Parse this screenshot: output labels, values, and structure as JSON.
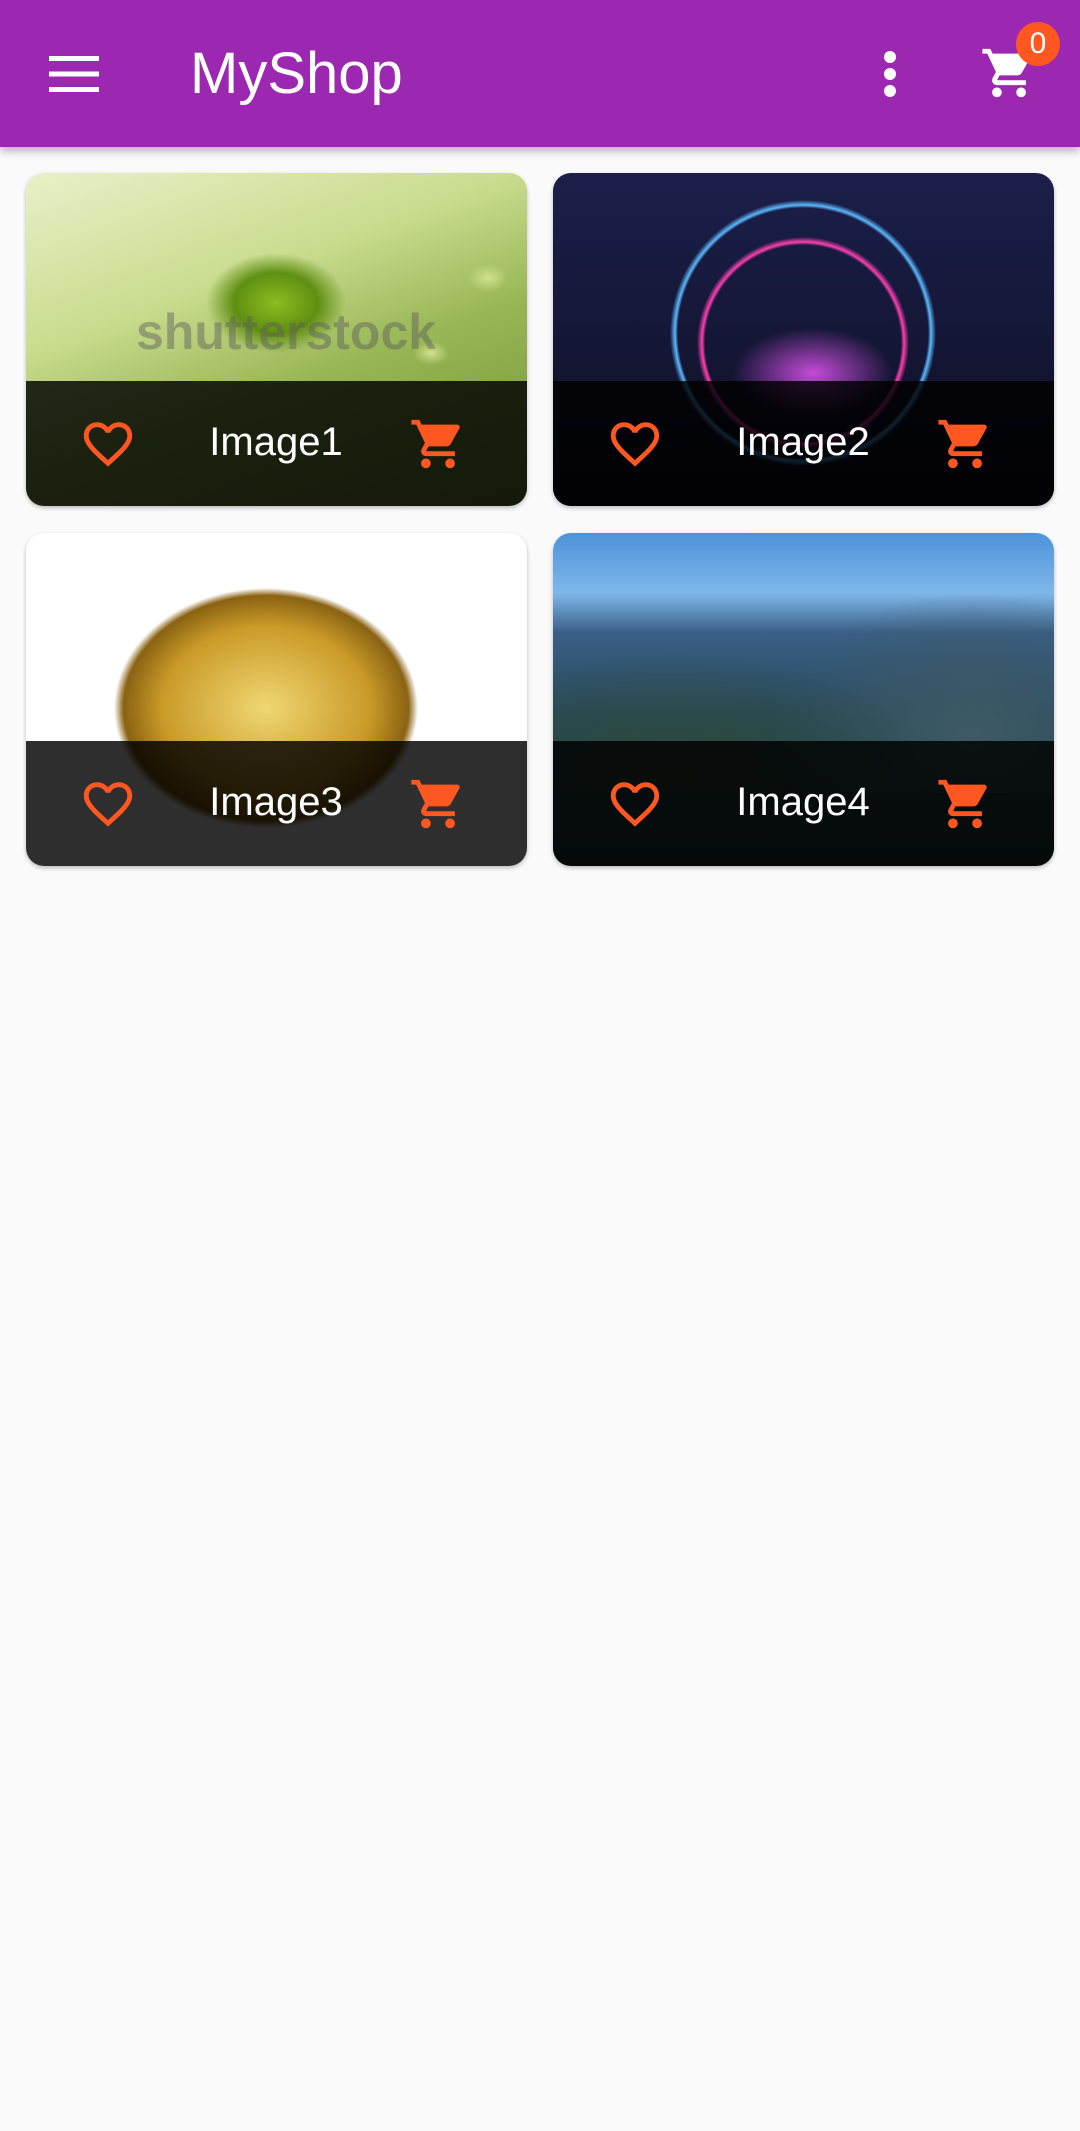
{
  "app_bar": {
    "title": "MyShop",
    "cart_count": "0",
    "color": "#9c27b0",
    "accent": "#ff5722"
  },
  "products": [
    {
      "name": "Image1",
      "watermark": "shutterstock"
    },
    {
      "name": "Image2"
    },
    {
      "name": "Image3"
    },
    {
      "name": "Image4"
    }
  ],
  "icons": {
    "menu": "hamburger-menu-icon",
    "more": "more-vert-icon",
    "cart": "shopping-cart-icon",
    "favorite": "heart-outline-icon",
    "add_to_cart": "shopping-cart-icon"
  }
}
